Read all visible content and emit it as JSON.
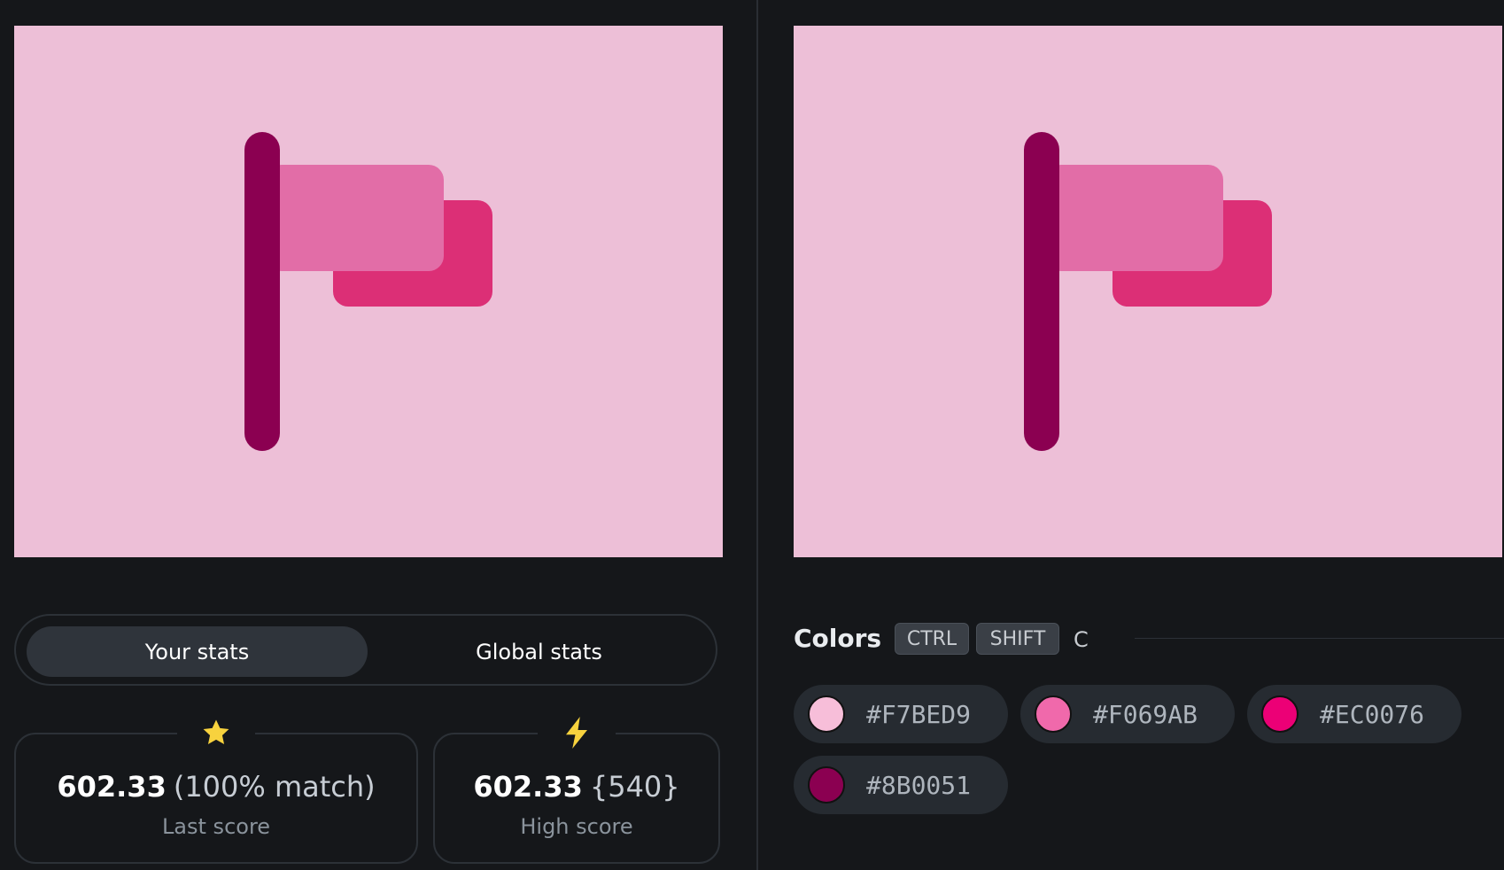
{
  "canvases": {
    "background": "#EDBFD7",
    "pole": "#8B0051",
    "flag_front": "#E26DA7",
    "flag_back": "#DC2F76"
  },
  "stats_toggle": {
    "your_stats": "Your stats",
    "global_stats": "Global stats",
    "active": "Your stats"
  },
  "last_score": {
    "icon": "star-icon",
    "value": "602.33",
    "extra": "(100% match)",
    "label": "Last score"
  },
  "high_score": {
    "icon": "lightning-icon",
    "value": "602.33",
    "extra": "{540}",
    "label": "High score"
  },
  "colors": {
    "title": "Colors",
    "shortcut": [
      "CTRL",
      "SHIFT",
      "C"
    ],
    "chips": [
      {
        "hex": "#F7BED9",
        "swatch": "#F7BED9"
      },
      {
        "hex": "#F069AB",
        "swatch": "#F069AB"
      },
      {
        "hex": "#EC0076",
        "swatch": "#EC0076"
      },
      {
        "hex": "#8B0051",
        "swatch": "#8B0051"
      }
    ]
  }
}
